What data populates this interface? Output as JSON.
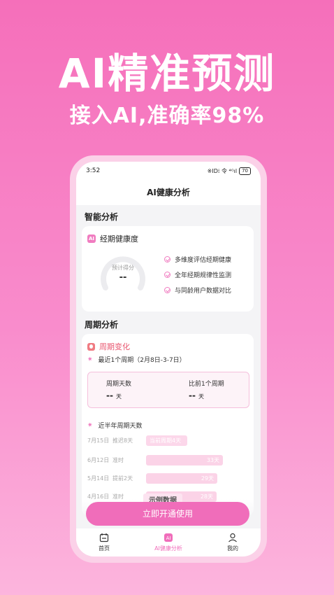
{
  "promo": {
    "title": "AI精准预测",
    "subtitle": "接入AI,准确率98%"
  },
  "status_bar": {
    "time": "3:52",
    "icons": "※ID⁞ 令 ⁴ᴳıl",
    "battery": "70"
  },
  "nav": {
    "title": "AI健康分析"
  },
  "smart_analysis": {
    "section_title": "智能分析",
    "card_title": "经期健康度",
    "badge": "AI",
    "gauge_label": "预计得分",
    "gauge_value": "--",
    "features": [
      "多维度评估经期健康",
      "全年经期规律性监测",
      "与同龄用户数据对比"
    ]
  },
  "cycle_analysis": {
    "section_title": "周期分析",
    "card_title": "周期变化",
    "recent_label": "最近1个周期（2月8日-3-7日）",
    "cycle_days_label": "周期天数",
    "cycle_days_value": "--",
    "cycle_days_unit": "天",
    "compare_label": "比前1个周期",
    "compare_value": "--",
    "compare_unit": "天",
    "half_year_label": "近半年周期天数",
    "rows": [
      {
        "date": "7月15日",
        "status": "推迟8天",
        "bar_text": "当前周期4天",
        "fraction": 0.4
      },
      {
        "date": "6月12日",
        "status": "准时",
        "bar_text": "33天",
        "fraction": 0.74
      },
      {
        "date": "5月14日",
        "status": "提前2天",
        "bar_text": "29天",
        "fraction": 0.69
      },
      {
        "date": "4月16日",
        "status": "准时",
        "bar_text": "28天",
        "fraction": 0.68
      }
    ],
    "watermark": "示例数据"
  },
  "cta": {
    "label": "立即开通使用"
  },
  "tabs": [
    {
      "label": "首页",
      "icon": "calendar-icon"
    },
    {
      "label": "AI健康分析",
      "icon": "ai-icon"
    },
    {
      "label": "我的",
      "icon": "user-icon"
    }
  ],
  "colors": {
    "accent": "#f06dba",
    "background_top": "#f56fba",
    "card_bg": "#ffffff",
    "cycle_title": "#e8556e"
  }
}
